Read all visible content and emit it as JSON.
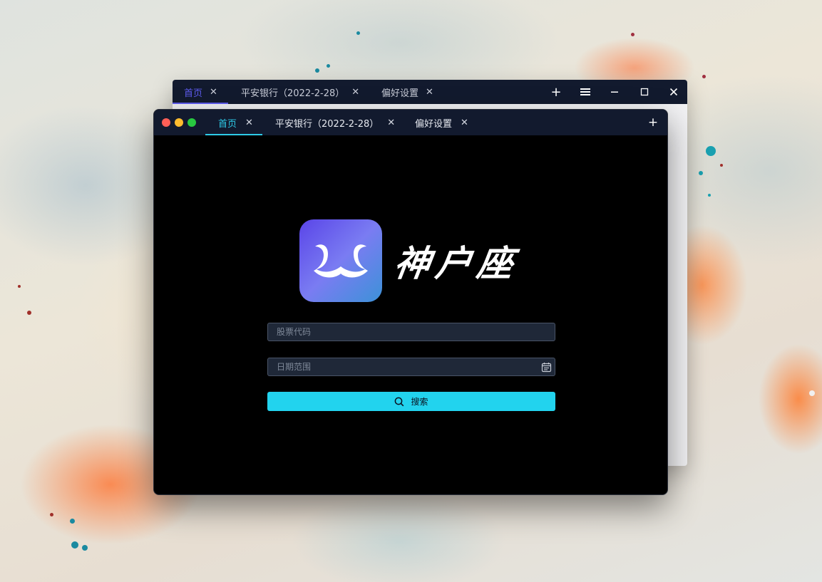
{
  "back_window": {
    "tabs": [
      {
        "label": "首页",
        "active": true
      },
      {
        "label": "平安银行（2022-2-28）",
        "active": false
      },
      {
        "label": "偏好设置",
        "active": false
      }
    ],
    "close_glyph": "✕",
    "controls": {
      "add": "+",
      "menu": "≡",
      "minimize": "−",
      "maximize": "□",
      "close": "✕"
    }
  },
  "front_window": {
    "tabs": [
      {
        "label": "首页",
        "active": true
      },
      {
        "label": "平安银行（2022-2-28）",
        "active": false
      },
      {
        "label": "偏好设置",
        "active": false
      }
    ],
    "close_glyph": "✕",
    "add_tab": "+",
    "traffic_lights": {
      "close": "#ff5f57",
      "minimize": "#febc2e",
      "zoom": "#28c840"
    }
  },
  "brand": {
    "name": "神户座",
    "logo_icon": "double-hook-logo-icon"
  },
  "form": {
    "stock_code_placeholder": "股票代码",
    "stock_code_value": "",
    "date_range_placeholder": "日期范围",
    "date_range_value": "",
    "calendar_icon": "calendar-icon",
    "search_icon": "search-icon",
    "search_label": "搜索"
  },
  "colors": {
    "titlebar": "#121a2e",
    "front_accent": "#2ecbe8",
    "back_accent": "#5e5cf0",
    "button": "#22d3ee",
    "input_bg": "#1f2838"
  }
}
